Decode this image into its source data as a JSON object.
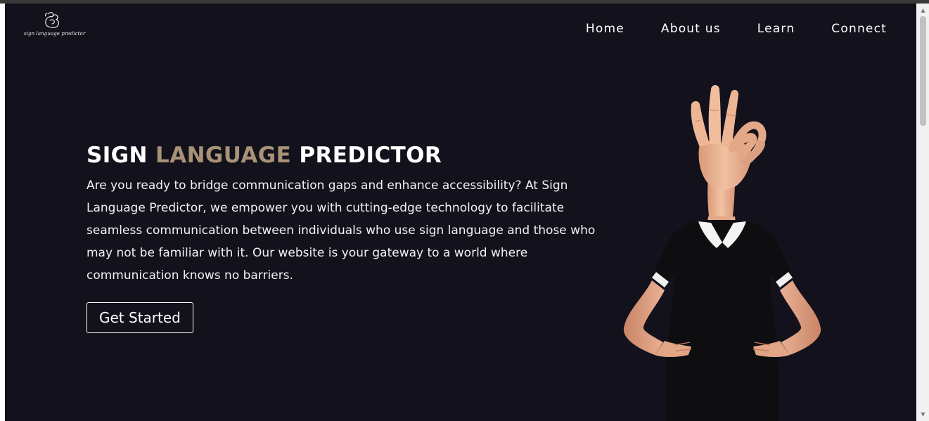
{
  "logo": {
    "text": "sign language predictor",
    "icon": "hand-gesture-icon"
  },
  "nav": {
    "items": [
      {
        "label": "Home"
      },
      {
        "label": "About us"
      },
      {
        "label": "Learn"
      },
      {
        "label": "Connect"
      }
    ]
  },
  "hero": {
    "title_part1": "SIGN ",
    "title_accent": "LANGUAGE",
    "title_part2": " PREDICTOR",
    "description": "Are you ready to bridge communication gaps and enhance accessibility? At Sign Language Predictor, we empower you with cutting-edge technology to facilitate seamless communication between individuals who use sign language and those who may not be familiar with it. Our website is your gateway to a world where communication knows no barriers.",
    "cta_label": "Get Started"
  },
  "colors": {
    "background": "#12111c",
    "accent": "#a89277",
    "text": "#ffffff"
  },
  "illustration": {
    "icon": "ok-hand-sign-person-image"
  },
  "scrollbar": {
    "up_icon": "scroll-up-arrow-icon",
    "down_icon": "scroll-down-arrow-icon"
  }
}
